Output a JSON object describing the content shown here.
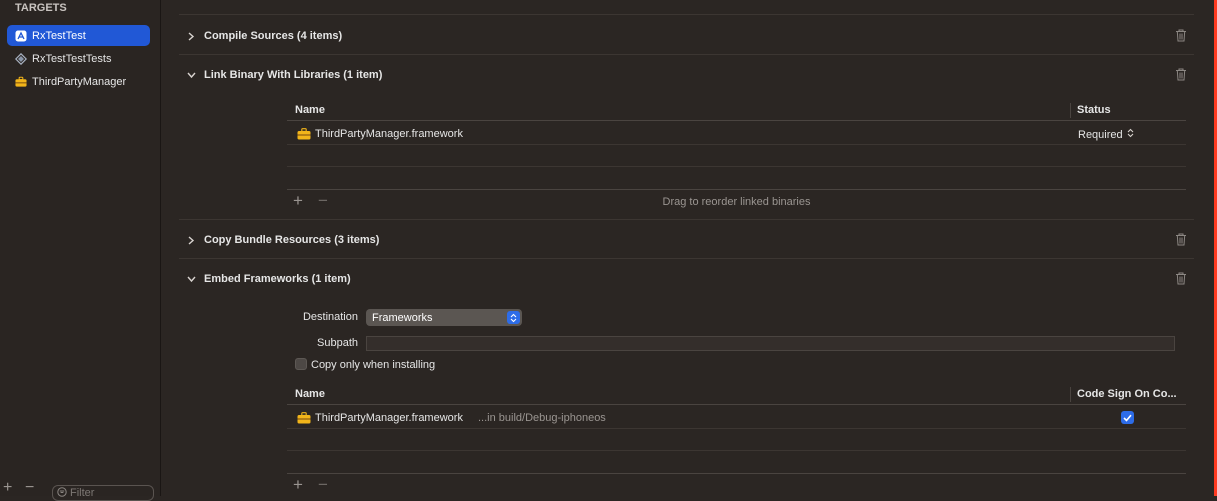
{
  "sidebar": {
    "header": "TARGETS",
    "items": [
      {
        "label": "RxTestTest",
        "icon": "app-target-icon",
        "selected": true
      },
      {
        "label": "RxTestTestTests",
        "icon": "test-bundle-icon",
        "selected": false
      },
      {
        "label": "ThirdPartyManager",
        "icon": "framework-toolbox-icon",
        "selected": false
      }
    ],
    "add_label": "+",
    "remove_label": "−",
    "filter_placeholder": "Filter"
  },
  "build_phases": {
    "compile_sources": {
      "title": "Compile Sources (4 items)",
      "expanded": false
    },
    "link_binary": {
      "title": "Link Binary With Libraries (1 item)",
      "expanded": true,
      "columns": {
        "name": "Name",
        "status": "Status"
      },
      "rows": [
        {
          "name": "ThirdPartyManager.framework",
          "status": "Required"
        }
      ],
      "footer_hint": "Drag to reorder linked binaries",
      "add_label": "+",
      "remove_label": "−"
    },
    "copy_bundle": {
      "title": "Copy Bundle Resources (3 items)",
      "expanded": false
    },
    "embed_frameworks": {
      "title": "Embed Frameworks (1 item)",
      "expanded": true,
      "destination_label": "Destination",
      "destination_value": "Frameworks",
      "subpath_label": "Subpath",
      "subpath_value": "",
      "copy_only_label": "Copy only when installing",
      "copy_only_checked": false,
      "columns": {
        "name": "Name",
        "code_sign": "Code Sign On Co..."
      },
      "rows": [
        {
          "name": "ThirdPartyManager.framework",
          "location": "...in build/Debug-iphoneos",
          "code_sign": true
        }
      ],
      "add_label": "+",
      "remove_label": "−"
    }
  },
  "colors": {
    "accent": "#2d6ce8",
    "selection": "#2158d6",
    "background": "#2b2623",
    "framework_icon": "#f2b51a"
  }
}
